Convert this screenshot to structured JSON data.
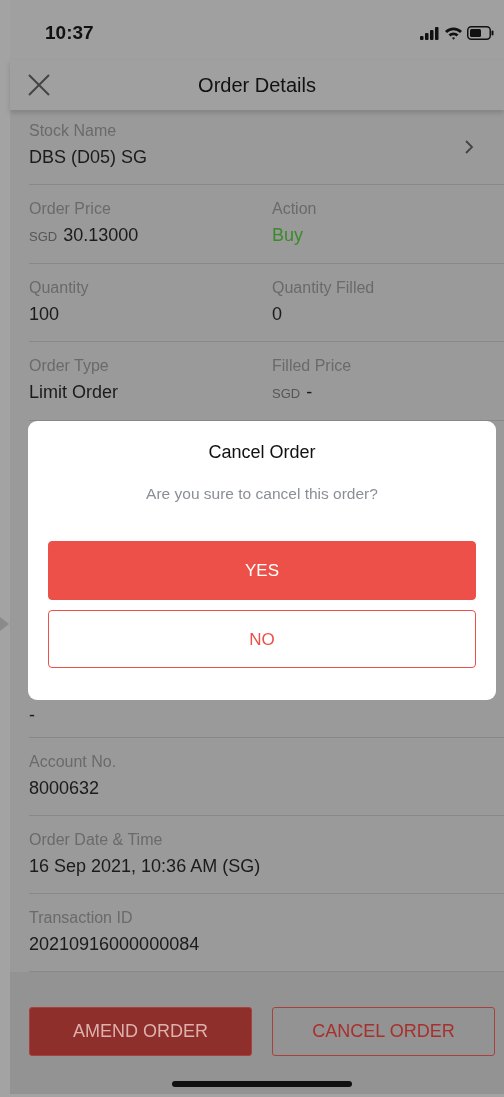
{
  "status_bar": {
    "time": "10:37"
  },
  "header": {
    "title": "Order Details"
  },
  "rows_before": [
    {
      "kind": "link",
      "cells": [
        {
          "label": "Stock Name",
          "value": "DBS (D05) SG"
        }
      ]
    },
    {
      "kind": "plain",
      "cells": [
        {
          "label": "Order Price",
          "currency": "SGD",
          "value": "30.13000"
        },
        {
          "label": "Action",
          "value": "Buy",
          "color": "#3b8a2c"
        }
      ]
    },
    {
      "kind": "plain",
      "cells": [
        {
          "label": "Quantity",
          "value": "100"
        },
        {
          "label": "Quantity Filled",
          "value": "0"
        }
      ]
    },
    {
      "kind": "plain",
      "cells": [
        {
          "label": "Order Type",
          "value": "Limit Order"
        },
        {
          "label": "Filled Price",
          "currency": "SGD",
          "value": "-"
        }
      ]
    }
  ],
  "dialog": {
    "title": "Cancel Order",
    "message": "Are you sure to cancel this order?",
    "buttons": [
      {
        "label": "YES",
        "kind": "filled"
      },
      {
        "label": "NO",
        "kind": "outline"
      }
    ]
  },
  "rows_after": [
    {
      "kind": "value-only",
      "cells": [
        {
          "value": "-"
        }
      ]
    },
    {
      "kind": "plain",
      "cells": [
        {
          "label": "Account No.",
          "value": "8000632"
        }
      ]
    },
    {
      "kind": "plain",
      "cells": [
        {
          "label": "Order Date & Time",
          "value": "16 Sep 2021, 10:36 AM (SG)"
        }
      ]
    },
    {
      "kind": "plain",
      "cells": [
        {
          "label": "Transaction ID",
          "value": "20210916000000084"
        }
      ]
    }
  ],
  "footer_buttons": [
    {
      "label": "AMEND ORDER",
      "kind": "filled"
    },
    {
      "label": "CANCEL ORDER",
      "kind": "outline"
    }
  ]
}
